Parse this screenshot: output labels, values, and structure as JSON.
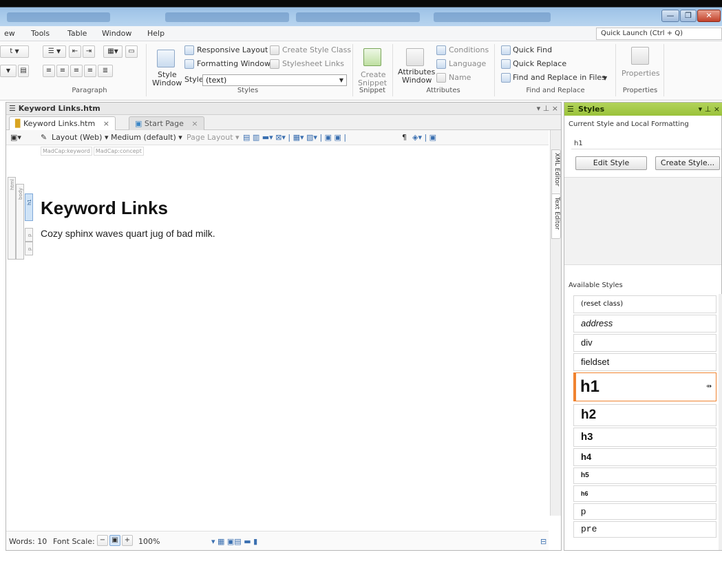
{
  "window": {
    "minimize": "—",
    "restore": "❐",
    "close": "✕"
  },
  "menu": {
    "items": [
      "ew",
      "Tools",
      "Table",
      "Window",
      "Help"
    ],
    "quick_launch": "Quick Launch (Ctrl + Q)"
  },
  "ribbon": {
    "paragraph_label": "Paragraph",
    "styles": {
      "responsive_layout": "Responsive Layout",
      "create_style_class": "Create Style Class",
      "formatting_window": "Formatting Window",
      "stylesheet_links": "Stylesheet Links",
      "style_window_line1": "Style",
      "style_window_line2": "Window",
      "style_label": "Style",
      "style_value": "(text)",
      "group_label": "Styles"
    },
    "snippet": {
      "create_line1": "Create",
      "create_line2": "Snippet",
      "group_label": "Snippet"
    },
    "attributes": {
      "window_line1": "Attributes",
      "window_line2": "Window",
      "conditions": "Conditions",
      "language": "Language",
      "name": "Name",
      "group_label": "Attributes"
    },
    "find": {
      "quick_find": "Quick Find",
      "quick_replace": "Quick Replace",
      "find_replace_files": "Find and Replace in Files",
      "group_label": "Find and Replace"
    },
    "properties": {
      "button": "Properties",
      "group_label": "Properties"
    }
  },
  "document": {
    "pane_title": "Keyword Links.htm",
    "tabs": [
      {
        "label": "Keyword Links.htm",
        "close": "×"
      },
      {
        "label": "Start Page",
        "close": "×"
      }
    ],
    "toolbar": {
      "layout": "Layout (Web)",
      "medium": "Medium (default)",
      "page_layout": "Page Layout",
      "pilcrow": "¶"
    },
    "chips": [
      "MadCap:keyword",
      "MadCap:concept"
    ],
    "structure": {
      "html": "html",
      "body": "body",
      "h1": "h1",
      "p1": "p",
      "p2": "p"
    },
    "heading": "Keyword Links",
    "paragraph": "Cozy sphinx waves quart jug of bad milk.",
    "side_tabs": {
      "xml": "XML Editor",
      "text": "Text Editor"
    },
    "status": {
      "words": "Words: 10",
      "font_scale": "Font Scale:",
      "zoom": "100%",
      "minus": "−",
      "plus": "+"
    }
  },
  "styles_pane": {
    "title": "Styles",
    "current_label": "Current Style and Local Formatting",
    "current_value": "h1",
    "edit_style": "Edit Style",
    "create_style": "Create Style...",
    "available_label": "Available Styles",
    "items": [
      {
        "name": "(reset class)"
      },
      {
        "name": "address"
      },
      {
        "name": "div"
      },
      {
        "name": "fieldset"
      },
      {
        "name": "h1"
      },
      {
        "name": "h2"
      },
      {
        "name": "h3"
      },
      {
        "name": "h4"
      },
      {
        "name": "h5"
      },
      {
        "name": "h6"
      },
      {
        "name": "p"
      },
      {
        "name": "pre"
      }
    ],
    "selected": "h1",
    "accent_color": "#f08330"
  }
}
